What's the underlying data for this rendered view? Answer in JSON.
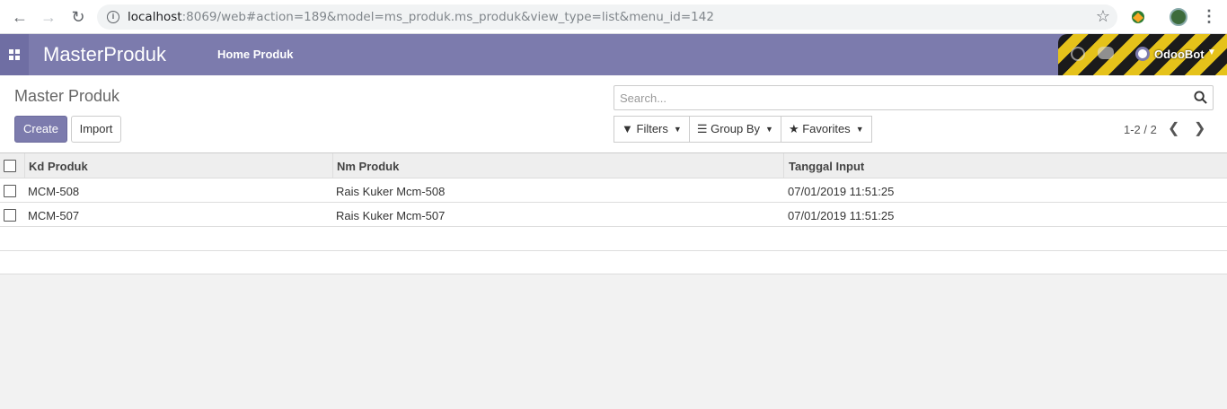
{
  "browser": {
    "url_host": "localhost",
    "url_rest": ":8069/web#action=189&model=ms_produk.ms_produk&view_type=list&menu_id=142",
    "back_glyph": "←",
    "forward_glyph": "→",
    "reload_glyph": "↻",
    "star_glyph": "☆",
    "menu_glyph": "⋮"
  },
  "navbar": {
    "brand": "MasterProduk",
    "menu_item": "Home Produk",
    "user_name": "OdooBot",
    "color": "#7c7bad"
  },
  "control_panel": {
    "breadcrumb": "Master Produk",
    "create_label": "Create",
    "import_label": "Import",
    "search_placeholder": "Search...",
    "filters_label": "Filters",
    "group_by_label": "Group By",
    "favorites_label": "Favorites",
    "pager": "1-2 / 2"
  },
  "table": {
    "columns": [
      "Kd Produk",
      "Nm Produk",
      "Tanggal Input"
    ],
    "rows": [
      {
        "kd": "MCM-508",
        "nm": "Rais Kuker Mcm-508",
        "tanggal": "07/01/2019 11:51:25"
      },
      {
        "kd": "MCM-507",
        "nm": "Rais Kuker Mcm-507",
        "tanggal": "07/01/2019 11:51:25"
      }
    ]
  }
}
